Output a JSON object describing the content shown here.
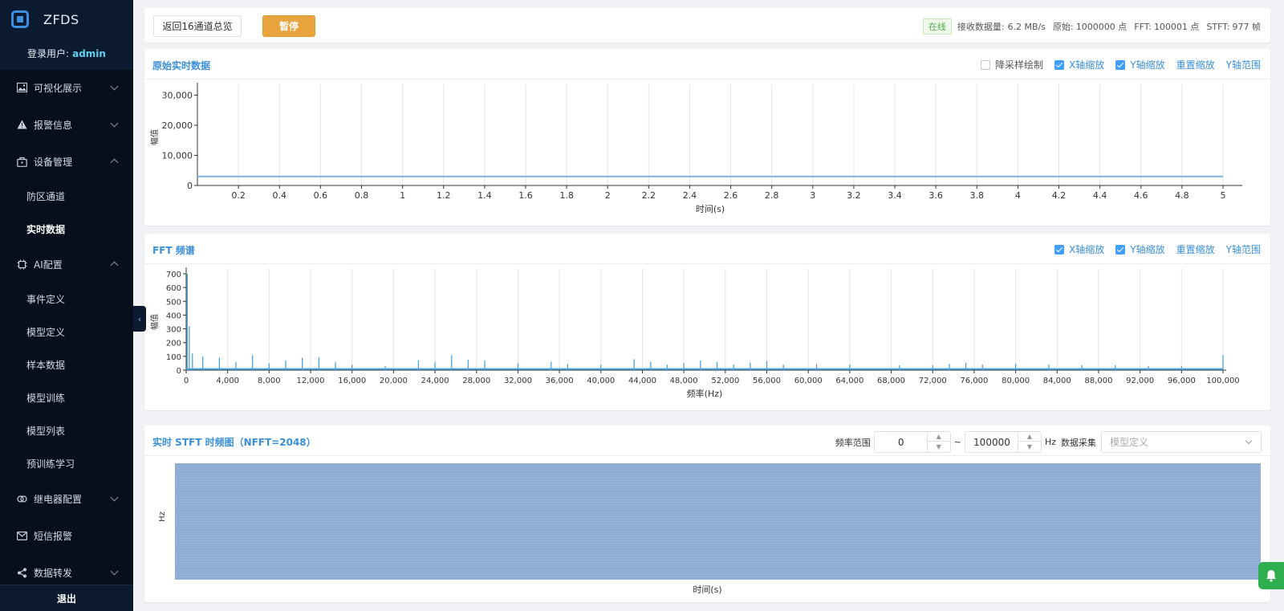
{
  "app": {
    "brand": "ZFDS",
    "user_label": "登录用户:",
    "user_name": "admin",
    "logout": "退出"
  },
  "sidebar": {
    "items": [
      {
        "label": "可视化展示",
        "icon": "image-icon"
      },
      {
        "label": "报警信息",
        "icon": "warning-icon"
      },
      {
        "label": "设备管理",
        "icon": "bag-icon"
      },
      {
        "label": "防区通道"
      },
      {
        "label": "实时数据"
      },
      {
        "label": "AI配置",
        "icon": "chip-icon"
      },
      {
        "label": "事件定义"
      },
      {
        "label": "模型定义"
      },
      {
        "label": "样本数据"
      },
      {
        "label": "模型训练"
      },
      {
        "label": "模型列表"
      },
      {
        "label": "预训练学习"
      },
      {
        "label": "继电器配置",
        "icon": "relay-icon"
      },
      {
        "label": "短信报警",
        "icon": "mail-icon"
      },
      {
        "label": "数据转发",
        "icon": "share-icon"
      }
    ]
  },
  "topbar": {
    "back_label": "返回16通道总览",
    "pause_label": "暂停",
    "online": "在线",
    "recv_label": "接收数据量:",
    "recv_value": "6.2 MB/s",
    "raw_label": "原始:",
    "raw_value": "1000000 点",
    "fft_label": "FFT:",
    "fft_value": "100001 点",
    "stft_label": "STFT:",
    "stft_value": "977 帧"
  },
  "raw_panel": {
    "title": "原始实时数据",
    "downsample": "降采样绘制",
    "x_zoom": "X轴缩放",
    "y_zoom": "Y轴缩放",
    "reset": "重置缩放",
    "y_range": "Y轴范围"
  },
  "fft_panel": {
    "title": "FFT 频谱",
    "x_zoom": "X轴缩放",
    "y_zoom": "Y轴缩放",
    "reset": "重置缩放",
    "y_range": "Y轴范围"
  },
  "stft_panel": {
    "title": "实时 STFT 时频图（NFFT=2048）",
    "freq_range_label": "频率范围",
    "freq_min": "0",
    "freq_max": "100000",
    "tilde": "~",
    "hz": "Hz",
    "collect_label": "数据采集",
    "model_placeholder": "模型定义",
    "xlabel": "时间(s)",
    "ylabel": "Hz"
  },
  "chart_data": [
    {
      "type": "line",
      "xlabel": "时间(s)",
      "ylabel": "幅值",
      "xlim": [
        0,
        5
      ],
      "ylim": [
        0,
        32000
      ],
      "xticks": [
        "0.2",
        "0.4",
        "0.6",
        "0.8",
        "1",
        "1.2",
        "1.4",
        "1.6",
        "1.8",
        "2",
        "2.2",
        "2.4",
        "2.6",
        "2.8",
        "3",
        "3.2",
        "3.4",
        "3.6",
        "3.8",
        "4",
        "4.2",
        "4.4",
        "4.6",
        "4.8",
        "5"
      ],
      "yticks": [
        "0",
        "10,000",
        "20,000",
        "30,000"
      ],
      "x": [
        0,
        5
      ],
      "y": [
        3000,
        3000
      ],
      "grid": "vertical"
    },
    {
      "type": "line",
      "xlabel": "频率(Hz)",
      "ylabel": "幅值",
      "xlim": [
        0,
        100000
      ],
      "ylim": [
        0,
        700
      ],
      "xticks": [
        "0",
        "4,000",
        "8,000",
        "12,000",
        "16,000",
        "20,000",
        "24,000",
        "28,000",
        "32,000",
        "36,000",
        "40,000",
        "44,000",
        "48,000",
        "52,000",
        "56,000",
        "60,000",
        "64,000",
        "68,000",
        "72,000",
        "76,000",
        "80,000",
        "84,000",
        "88,000",
        "92,000",
        "96,000",
        "100,000"
      ],
      "yticks": [
        "0",
        "100",
        "200",
        "300",
        "400",
        "500",
        "600",
        "700"
      ],
      "x": [
        100,
        300,
        600,
        1600,
        3200,
        4800,
        6400,
        8000,
        9600,
        11200,
        12800,
        14400,
        16000,
        19200,
        22400,
        24000,
        25600,
        27200,
        28800,
        32000,
        35200,
        36800,
        40000,
        43200,
        44800,
        46400,
        48000,
        49600,
        51200,
        52800,
        54400,
        56000,
        57600,
        60800,
        64000,
        68800,
        72000,
        73600,
        75200,
        76800,
        80000,
        83200,
        86400,
        89600,
        92800,
        96000,
        100000
      ],
      "y": [
        700,
        320,
        120,
        100,
        90,
        60,
        110,
        50,
        70,
        90,
        95,
        60,
        40,
        30,
        70,
        60,
        110,
        75,
        70,
        50,
        60,
        45,
        40,
        80,
        60,
        40,
        50,
        70,
        60,
        40,
        55,
        65,
        40,
        45,
        40,
        35,
        35,
        45,
        55,
        40,
        45,
        40,
        35,
        35,
        30,
        30,
        110
      ],
      "grid": "vertical"
    }
  ]
}
